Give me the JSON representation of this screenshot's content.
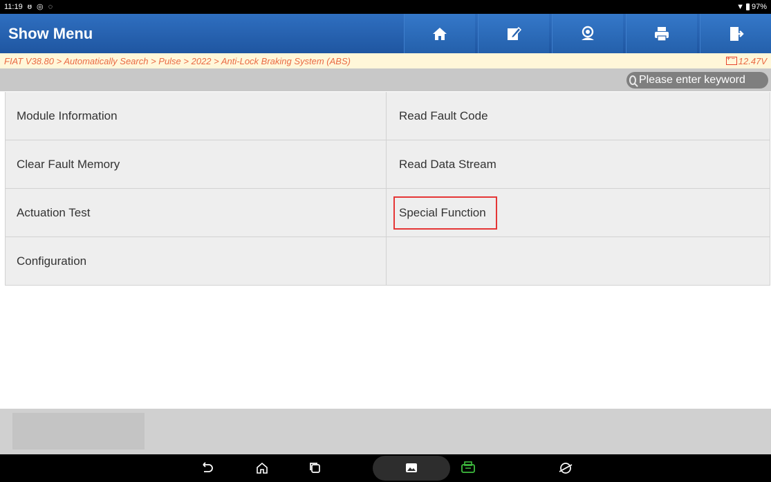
{
  "status_bar": {
    "time": "11:19",
    "battery": "97%"
  },
  "app": {
    "title": "Show Menu"
  },
  "toolbar": [
    {
      "name": "home-icon"
    },
    {
      "name": "edit-report-icon"
    },
    {
      "name": "user-support-icon"
    },
    {
      "name": "print-icon"
    },
    {
      "name": "exit-icon"
    }
  ],
  "breadcrumb": {
    "path": "FIAT V38.80 > Automatically Search > Pulse > 2022 > Anti-Lock Braking System (ABS)",
    "voltage": "12.47V"
  },
  "search": {
    "placeholder": "Please enter keyword"
  },
  "menu": {
    "items": [
      "Module Information",
      "Read Fault Code",
      "Clear Fault Memory",
      "Read Data Stream",
      "Actuation Test",
      "Special Function",
      "Configuration",
      ""
    ],
    "highlighted": "Special Function",
    "highlight_color": "#e53535"
  },
  "colors": {
    "title_bar": "#2563b0",
    "breadcrumb_text": "#ea6a43",
    "vci_icon": "#3fbf3f"
  },
  "navbar": {
    "icons": [
      "back-icon",
      "home-nav-icon",
      "recents-icon",
      "gallery-icon",
      "vci-icon",
      "browser-icon"
    ]
  }
}
